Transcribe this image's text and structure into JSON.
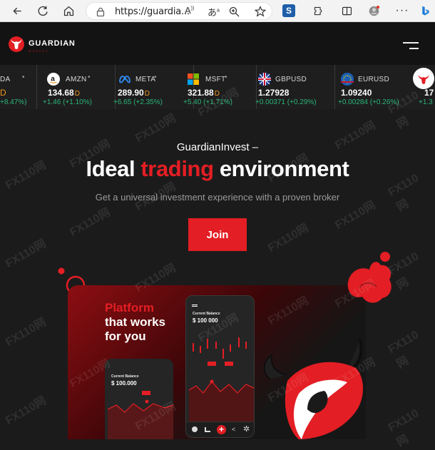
{
  "browser": {
    "url": "https://guardia...",
    "icons": [
      "back-icon",
      "refresh-icon",
      "home-icon",
      "lock-icon",
      "read-aloud-icon",
      "translate-icon",
      "zoom-icon",
      "favorite-icon",
      "extension-s-icon",
      "extensions-icon",
      "split-screen-icon",
      "profile-icon",
      "more-icon",
      "bing-icon"
    ]
  },
  "header": {
    "logo_text": "GUARDIAN",
    "logo_sub": "MARKET"
  },
  "ticker": [
    {
      "name": "DA",
      "price": "D",
      "change": "+8.47%)",
      "icon": "partial-icon"
    },
    {
      "name": "AMZN",
      "price": "134.68",
      "suffix": "D",
      "change": "+1.46 (+1.10%)",
      "icon": "amazon-icon"
    },
    {
      "name": "META",
      "price": "289.90",
      "suffix": "D",
      "change": "+6.65 (+2.35%)",
      "icon": "meta-icon"
    },
    {
      "name": "MSFT",
      "price": "321.88",
      "suffix": "D",
      "change": "+5.40 (+1.71%)",
      "icon": "microsoft-icon"
    },
    {
      "name": "GBPUSD",
      "price": "1.27928",
      "suffix": "",
      "change": "+0.00371 (+0.29%)",
      "icon": "uk-flag-icon"
    },
    {
      "name": "EURUSD",
      "price": "1.09240",
      "suffix": "",
      "change": "+0.00284 (+0.26%)",
      "icon": "eu-flag-icon"
    },
    {
      "name": "",
      "price": "17",
      "suffix": "",
      "change": "+1.3",
      "icon": "bull-logo-icon"
    }
  ],
  "hero": {
    "brand": "GuardianInvest",
    "dash": "–",
    "headline_before": "Ideal ",
    "headline_accent": "trading",
    "headline_after": " environment",
    "subline": "Get a universal investment experience with a proven broker",
    "join_label": "Join"
  },
  "platform": {
    "title_accent": "Platform",
    "title_line2": "that works",
    "title_line3": "for you",
    "phone1_label": "Current Balance",
    "phone1_balance": "$ 100.000",
    "phone2_label": "Current Balance",
    "phone2_balance": "$ 100 000"
  },
  "watermark": "FX110网",
  "colors": {
    "accent": "#e31e24",
    "positive": "#2bb57a",
    "suffix": "#f0941d"
  }
}
